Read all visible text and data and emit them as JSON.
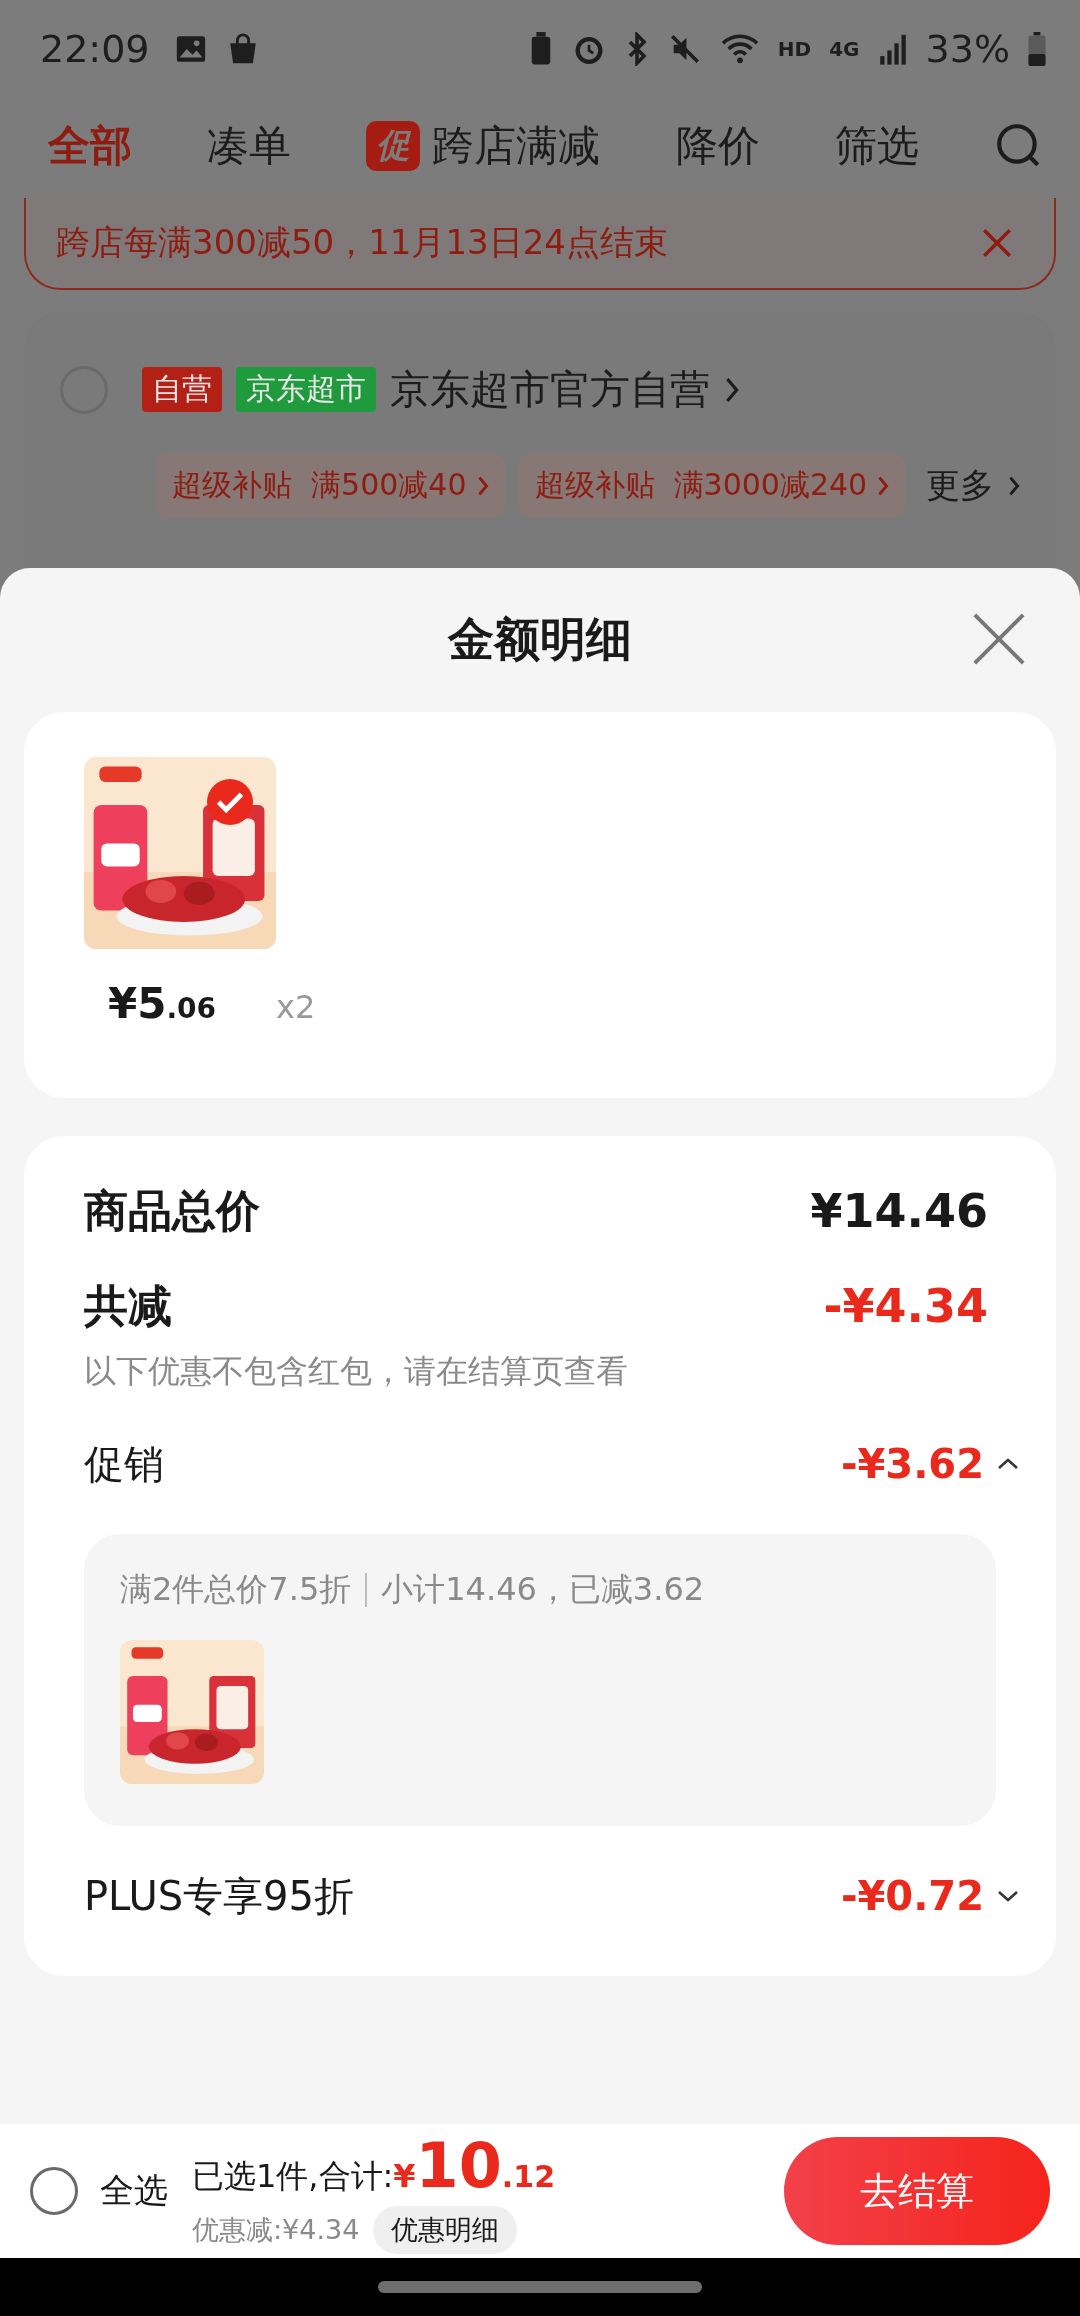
{
  "status_bar": {
    "time": "22:09",
    "network_labels": [
      "HD",
      "4G"
    ],
    "battery": "33%"
  },
  "background_page": {
    "tabs": [
      {
        "label": "全部",
        "selected": true,
        "kind": "text"
      },
      {
        "label": "凑单",
        "selected": false,
        "kind": "text"
      },
      {
        "label": "跨店满减",
        "selected": false,
        "kind": "promo",
        "badge": "促"
      },
      {
        "label": "降价",
        "selected": false,
        "kind": "text"
      },
      {
        "label": "筛选",
        "selected": false,
        "kind": "text"
      }
    ],
    "banner": {
      "text": "跨店每满300减50，11月13日24点结束"
    },
    "store": {
      "checked": false,
      "tags": [
        {
          "text": "自营",
          "color": "#b32015"
        },
        {
          "text": "京东超市",
          "color": "#1f9a3c"
        }
      ],
      "name": "京东超市官方自营",
      "coupons": [
        "超级补贴  满500减40",
        "超级补贴  满3000减240"
      ],
      "more": "更多"
    }
  },
  "sheet": {
    "title": "金额明细",
    "product": {
      "checked": true,
      "price": "¥5",
      "price_decimal": ".06",
      "quantity": "x2"
    },
    "summary": [
      {
        "kind": "total",
        "label": "商品总价",
        "value": "¥14.46"
      },
      {
        "kind": "discount",
        "label": "共减",
        "value": "-¥4.34",
        "note": "以下优惠不包含红包，请在结算页查看"
      }
    ],
    "promotions": [
      {
        "label": "促销",
        "value": "-¥3.62",
        "expanded": true,
        "detail": "满2件总价7.5折",
        "detail_sum": "小计14.46，已减3.62"
      },
      {
        "label": "PLUS专享95折",
        "value": "-¥0.72",
        "expanded": false
      }
    ]
  },
  "bottom_bar": {
    "select_all": {
      "label": "全选",
      "checked": false
    },
    "selected_text": "已选1件,合计:",
    "currency": "¥",
    "total": "10",
    "total_decimal": ".12",
    "saving": "优惠减:¥4.34",
    "detail_button": "优惠明细",
    "checkout": "去结算"
  }
}
